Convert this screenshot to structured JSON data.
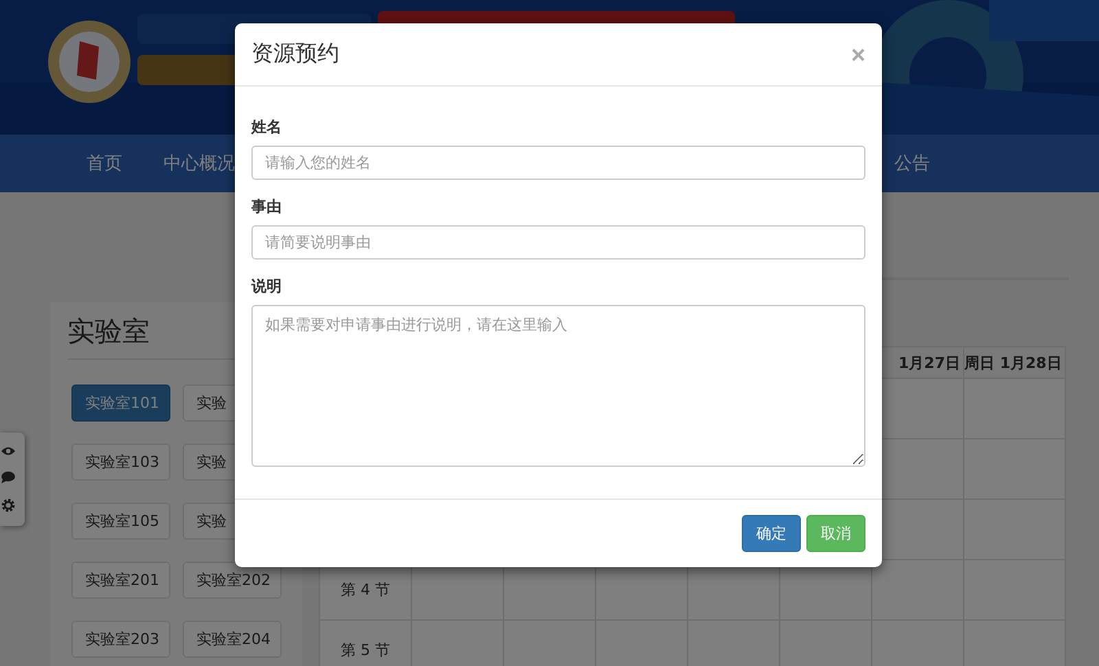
{
  "nav": {
    "items": [
      {
        "label": "首页"
      },
      {
        "label": "中心概况"
      },
      {
        "label": "公告"
      }
    ]
  },
  "lab_panel": {
    "title": "实验室",
    "rooms": [
      {
        "label": "实验室101",
        "selected": true
      },
      {
        "label": "实验",
        "selected": false
      },
      {
        "label": "实验室103",
        "selected": false
      },
      {
        "label": "实验",
        "selected": false
      },
      {
        "label": "实验室105",
        "selected": false
      },
      {
        "label": "实验",
        "selected": false
      },
      {
        "label": "实验室201",
        "selected": false
      },
      {
        "label": "实验室202",
        "selected": false
      },
      {
        "label": "实验室203",
        "selected": false
      },
      {
        "label": "实验室204",
        "selected": false
      }
    ]
  },
  "schedule": {
    "columns": [
      "1月27日",
      "周日 1月28日"
    ],
    "rows": [
      "第 4 节",
      "第 5 节"
    ]
  },
  "dialog": {
    "title": "资源预约",
    "close": "×",
    "fields": [
      {
        "label": "姓名",
        "placeholder": "请输入您的姓名",
        "kind": "input"
      },
      {
        "label": "事由",
        "placeholder": "请简要说明事由",
        "kind": "input"
      },
      {
        "label": "说明",
        "placeholder": "如果需要对申请事由进行说明，请在这里输入",
        "kind": "textarea"
      }
    ],
    "buttons": [
      {
        "label": "确定",
        "kind": "primary"
      },
      {
        "label": "取消",
        "kind": "success"
      }
    ]
  }
}
